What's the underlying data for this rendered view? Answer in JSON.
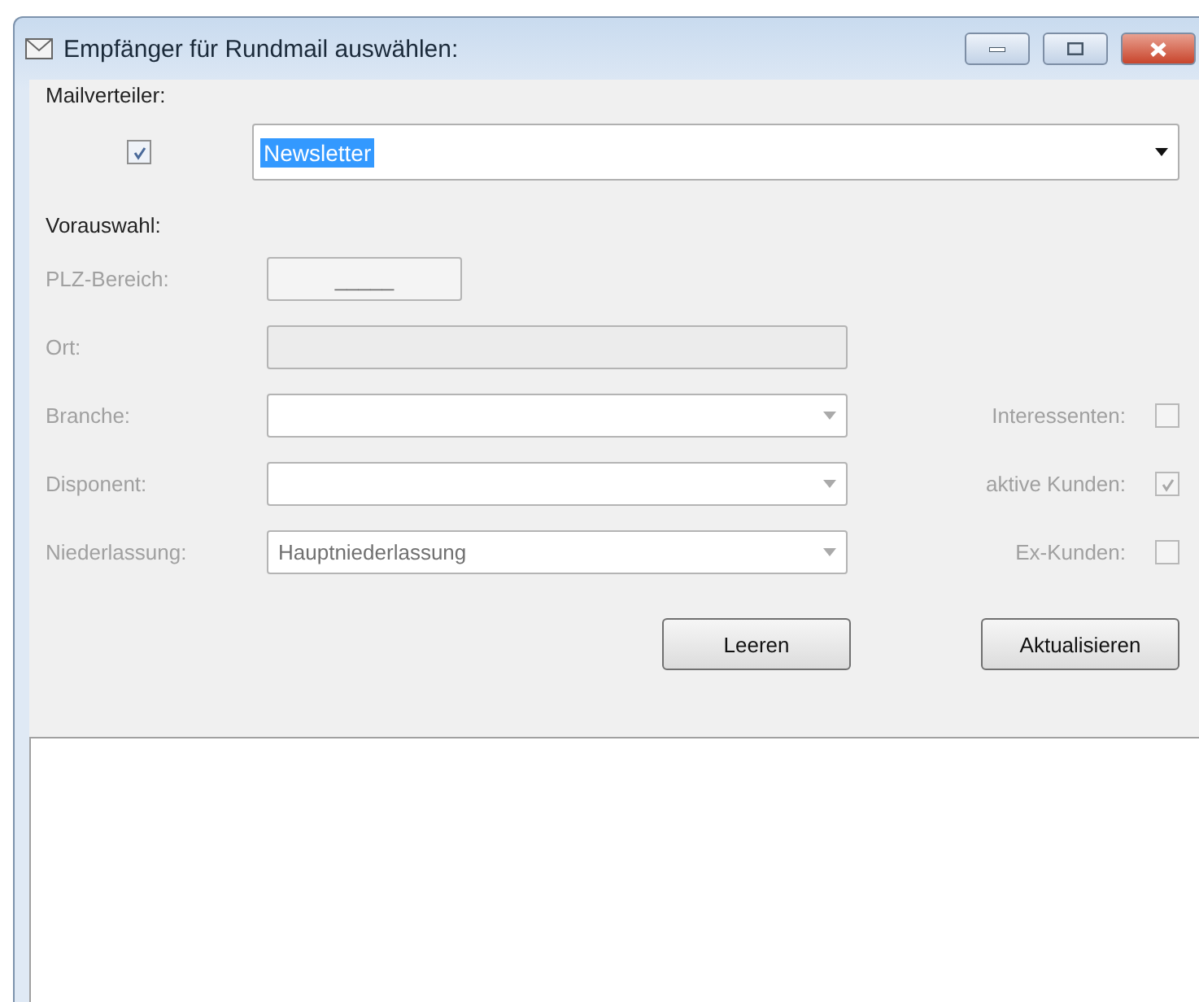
{
  "window": {
    "title": "Empfänger für Rundmail auswählen:"
  },
  "mailverteiler": {
    "label": "Mailverteiler:",
    "checked": true,
    "value": "Newsletter",
    "value_selected": true
  },
  "vorauswahl": {
    "label": "Vorauswahl:",
    "fields": [
      {
        "kind": "masked",
        "label": "PLZ-Bereich:",
        "value": "_____",
        "disabled": true
      },
      {
        "kind": "text",
        "label": "Ort:",
        "disabled": true
      },
      {
        "kind": "combo",
        "label": "Branche:",
        "disabled": true
      },
      {
        "kind": "combo",
        "label": "Disponent:",
        "disabled": true
      },
      {
        "kind": "combo",
        "label": "Niederlassung:",
        "value": "Hauptniederlassung",
        "disabled": true
      }
    ],
    "checkboxes": [
      {
        "label": "Interessenten:",
        "checked": false,
        "disabled": true
      },
      {
        "label": "aktive Kunden:",
        "checked": true,
        "disabled": true
      },
      {
        "label": "Ex-Kunden:",
        "checked": false,
        "disabled": true
      }
    ]
  },
  "buttons": [
    {
      "label": "Leeren"
    },
    {
      "label": "Aktualisieren"
    }
  ]
}
